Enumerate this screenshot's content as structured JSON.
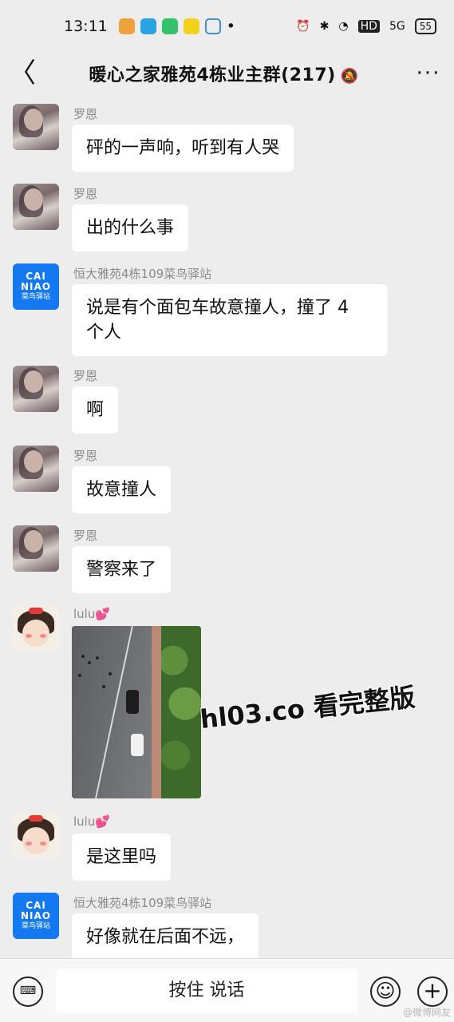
{
  "status_bar": {
    "time": "13:11",
    "dot": "•",
    "signal_label": "5G",
    "battery": "55",
    "hd_label": "HD",
    "icons": [
      "alarm-off-icon",
      "bluetooth-icon",
      "wifi-icon",
      "hd-icon",
      "signal-icon",
      "battery-icon"
    ]
  },
  "header": {
    "back_glyph": "〈",
    "title": "暖心之家雅苑4栋业主群(217)",
    "mute_glyph": "🔕",
    "more_glyph": "···"
  },
  "messages": [
    {
      "sender": "罗恩",
      "text": "砰的一声响，听到有人哭",
      "avatar": "photo"
    },
    {
      "sender": "罗恩",
      "text": "出的什么事",
      "avatar": "photo"
    },
    {
      "sender": "恒大雅苑4栋109菜鸟驿站",
      "text": "说是有个面包车故意撞人，撞了 4\n个人",
      "avatar": "cainiao"
    },
    {
      "sender": "罗恩",
      "text": "啊",
      "avatar": "photo"
    },
    {
      "sender": "罗恩",
      "text": "故意撞人",
      "avatar": "photo"
    },
    {
      "sender": "罗恩",
      "text": "警察来了",
      "avatar": "photo"
    },
    {
      "sender": "lulu💕",
      "text": "",
      "avatar": "cartoon",
      "image": "street-accident-aerial-photo"
    },
    {
      "sender": "lulu💕",
      "text": "是这里吗",
      "avatar": "cartoon"
    },
    {
      "sender": "恒大雅苑4栋109菜鸟驿站",
      "text": "好像就在后面不远，",
      "avatar": "cainiao"
    }
  ],
  "avatar_text": {
    "cainiao_top": "CAI\nNIAO",
    "cainiao_bottom": "菜鸟驿站"
  },
  "watermark": "hl03.co 看完整版",
  "input_bar": {
    "voice_label": "按住 说话",
    "keyboard_glyph": "⌨",
    "emoji_glyph": "☺",
    "plus_glyph": "+"
  },
  "corner_mark": "@微博网友",
  "colors": {
    "background": "#ededed",
    "bubble": "#ffffff",
    "cainiao_blue": "#1478f0",
    "sender_gray": "#8a8a8a"
  }
}
